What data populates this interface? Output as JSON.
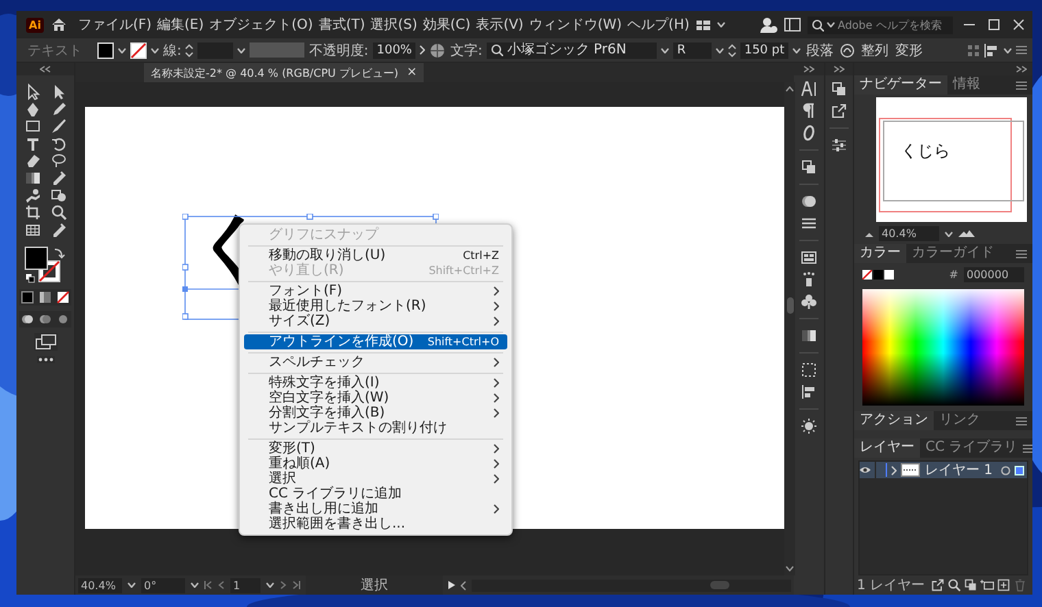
{
  "app": {
    "logo": "Ai"
  },
  "menu_bar": [
    "ファイル(F)",
    "編集(E)",
    "オブジェクト(O)",
    "書式(T)",
    "選択(S)",
    "効果(C)",
    "表示(V)",
    "ウィンドウ(W)",
    "ヘルプ(H)"
  ],
  "search": {
    "placeholder": "Adobe ヘルプを検索"
  },
  "control_bar": {
    "label": "テキスト",
    "stroke_label": "線:",
    "opacity_label": "不透明度:",
    "opacity": "100%",
    "font_label": "文字:",
    "font": "小塚ゴシック Pr6N",
    "style": "R",
    "size": "150 pt",
    "buttons": [
      "段落",
      "整列",
      "変形"
    ]
  },
  "document_tab": {
    "title": "名称未設定-2* @ 40.4 % (RGB/CPU プレビュー)",
    "close": "×"
  },
  "artboard": {
    "text": "く"
  },
  "context_menu": [
    {
      "kind": "item",
      "label": "グリフにスナップ",
      "disabled": true,
      "selected": false,
      "submenu": false
    },
    {
      "kind": "separator"
    },
    {
      "kind": "item",
      "label": "移動の取り消し(U)",
      "shortcut": "Ctrl+Z",
      "disabled": false,
      "selected": false,
      "submenu": false
    },
    {
      "kind": "item",
      "label": "やり直し(R)",
      "shortcut": "Shift+Ctrl+Z",
      "disabled": true,
      "selected": false,
      "submenu": false
    },
    {
      "kind": "separator"
    },
    {
      "kind": "item",
      "label": "フォント(F)",
      "disabled": false,
      "selected": false,
      "submenu": true
    },
    {
      "kind": "item",
      "label": "最近使用したフォント(R)",
      "disabled": false,
      "selected": false,
      "submenu": true
    },
    {
      "kind": "item",
      "label": "サイズ(Z)",
      "disabled": false,
      "selected": false,
      "submenu": true
    },
    {
      "kind": "separator"
    },
    {
      "kind": "item",
      "label": "アウトラインを作成(O)",
      "shortcut": "Shift+Ctrl+O",
      "disabled": false,
      "selected": true,
      "submenu": false
    },
    {
      "kind": "separator"
    },
    {
      "kind": "item",
      "label": "スペルチェック",
      "disabled": false,
      "selected": false,
      "submenu": true
    },
    {
      "kind": "separator"
    },
    {
      "kind": "item",
      "label": "特殊文字を挿入(I)",
      "disabled": false,
      "selected": false,
      "submenu": true
    },
    {
      "kind": "item",
      "label": "空白文字を挿入(W)",
      "disabled": false,
      "selected": false,
      "submenu": true
    },
    {
      "kind": "item",
      "label": "分割文字を挿入(B)",
      "disabled": false,
      "selected": false,
      "submenu": true
    },
    {
      "kind": "item",
      "label": "サンプルテキストの割り付け",
      "disabled": false,
      "selected": false,
      "submenu": false
    },
    {
      "kind": "separator"
    },
    {
      "kind": "item",
      "label": "変形(T)",
      "disabled": false,
      "selected": false,
      "submenu": true
    },
    {
      "kind": "item",
      "label": "重ね順(A)",
      "disabled": false,
      "selected": false,
      "submenu": true
    },
    {
      "kind": "item",
      "label": "選択",
      "disabled": false,
      "selected": false,
      "submenu": true
    },
    {
      "kind": "item",
      "label": "CC ライブラリに追加",
      "disabled": false,
      "selected": false,
      "submenu": false
    },
    {
      "kind": "item",
      "label": "書き出し用に追加",
      "disabled": false,
      "selected": false,
      "submenu": true
    },
    {
      "kind": "item",
      "label": "選択範囲を書き出し...",
      "disabled": false,
      "selected": false,
      "submenu": false
    }
  ],
  "navigator": {
    "tabs": [
      {
        "label": "ナビゲーター",
        "selected": true
      },
      {
        "label": "情報",
        "selected": false
      }
    ],
    "preview_text": "くじら",
    "zoom": "40.4%"
  },
  "color": {
    "tabs": [
      {
        "label": "カラー",
        "selected": true
      },
      {
        "label": "カラーガイド",
        "selected": false
      }
    ],
    "hex_label": "#",
    "hex": "000000"
  },
  "actions": {
    "tabs": [
      {
        "label": "アクション",
        "selected": true
      },
      {
        "label": "リンク",
        "selected": false
      }
    ]
  },
  "layers": {
    "tabs": [
      {
        "label": "レイヤー",
        "selected": true
      },
      {
        "label": "CC ライブラリ",
        "selected": false
      }
    ],
    "rows": [
      {
        "name": "レイヤー 1",
        "visible": true,
        "selected": true,
        "color": "#4f7dff"
      }
    ],
    "footer": "1 レイヤー"
  },
  "status_bar": {
    "zoom": "40.4%",
    "rotation": "0°",
    "artboard": "1",
    "tool": "選択"
  }
}
